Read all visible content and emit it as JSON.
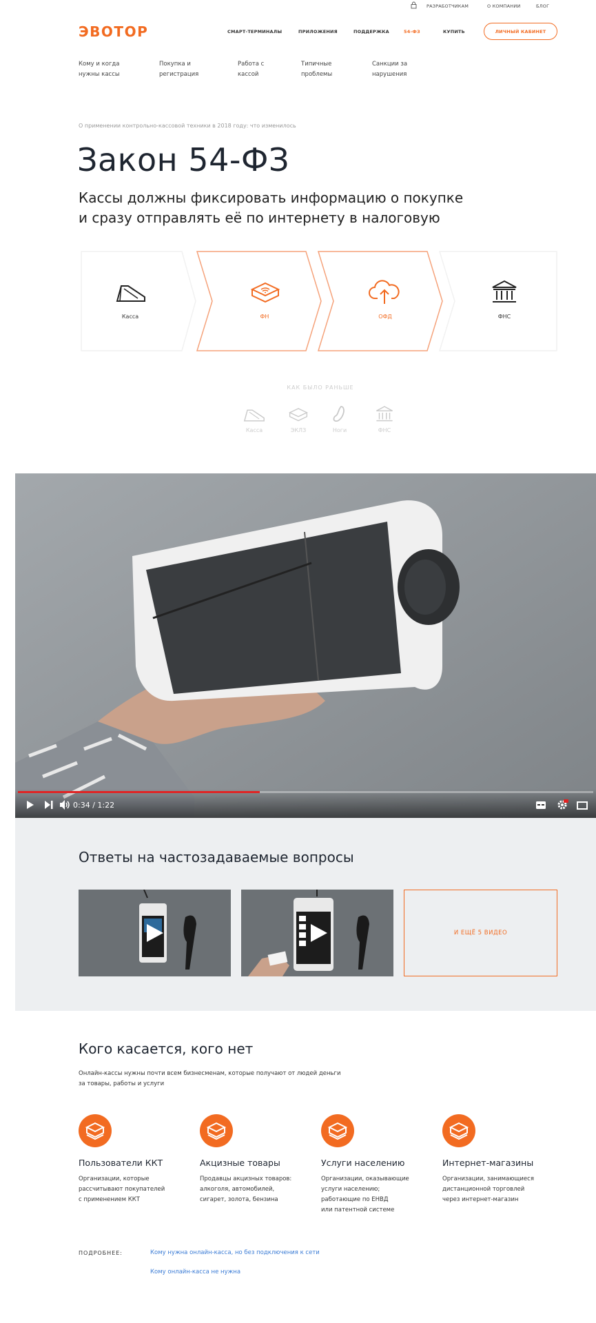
{
  "utility": {
    "developers": "РАЗРАБОТЧИКАМ",
    "about": "О КОМПАНИИ",
    "blog": "БЛОГ"
  },
  "header": {
    "logo": "ЭВОТОР",
    "nav": [
      "СМАРТ-ТЕРМИНАЛЫ",
      "ПРИЛОЖЕНИЯ",
      "ПОДДЕРЖКА",
      "54-ФЗ",
      "КУПИТЬ"
    ],
    "cabinet": "ЛИЧНЫЙ КАБИНЕТ"
  },
  "subnav": [
    "Кому и когда нужны кассы",
    "Покупка и регистрация",
    "Работа с кассой",
    "Типичные проблемы",
    "Санкции за нарушения"
  ],
  "hero": {
    "breadcrumb": "О применении контрольно-кассовой техники в 2018 году: что изменилось",
    "title": "Закон 54-ФЗ",
    "subtitle_line1": "Кассы должны фиксировать информацию о покупке",
    "subtitle_line2": "и сразу отправлять её по интернету в налоговую"
  },
  "flow": {
    "steps": [
      "Касса",
      "ФН",
      "ОФД",
      "ФНС"
    ]
  },
  "before": {
    "title": "КАК БЫЛО РАНЬШЕ",
    "steps": [
      "Касса",
      "ЭКЛЗ",
      "Ноги",
      "ФНС"
    ]
  },
  "video": {
    "time": "0:34 / 1:22",
    "progress": 0.42
  },
  "faq": {
    "title": "Ответы на частозадаваемые вопросы",
    "more": "И ЕЩЁ 5 ВИДЕО"
  },
  "who": {
    "title": "Кого касается, кого нет",
    "desc_line1": "Онлайн-кассы нужны почти всем бизнесменам, которые получают от людей деньги",
    "desc_line2": "за товары, работы и услуги",
    "categories": [
      {
        "title": "Пользователи ККТ",
        "l1": "Организации, которые",
        "l2": "рассчитывают покупателей",
        "l3": "с применением ККТ",
        "l4": ""
      },
      {
        "title": "Акцизные товары",
        "l1": "Продавцы акцизных товаров:",
        "l2": "алкоголя, автомобилей,",
        "l3": "сигарет, золота, бензина",
        "l4": ""
      },
      {
        "title": "Услуги населению",
        "l1": "Организации, оказывающие",
        "l2": "услуги населению;",
        "l3": "работающие по ЕНВД",
        "l4": "или патентной системе"
      },
      {
        "title": "Интернет-магазины",
        "l1": "Организации, занимающиеся",
        "l2": "дистанционной торговлей",
        "l3": "через интернет-магазин",
        "l4": ""
      }
    ]
  },
  "more": {
    "label": "ПОДРОБНЕЕ:",
    "link1": "Кому нужна онлайн-касса, но без подключения к сети",
    "link2": "Кому онлайн-касса не нужна"
  },
  "colors": {
    "accent": "#f26b21",
    "link": "#3a7bd5",
    "dark": "#1e2530"
  }
}
